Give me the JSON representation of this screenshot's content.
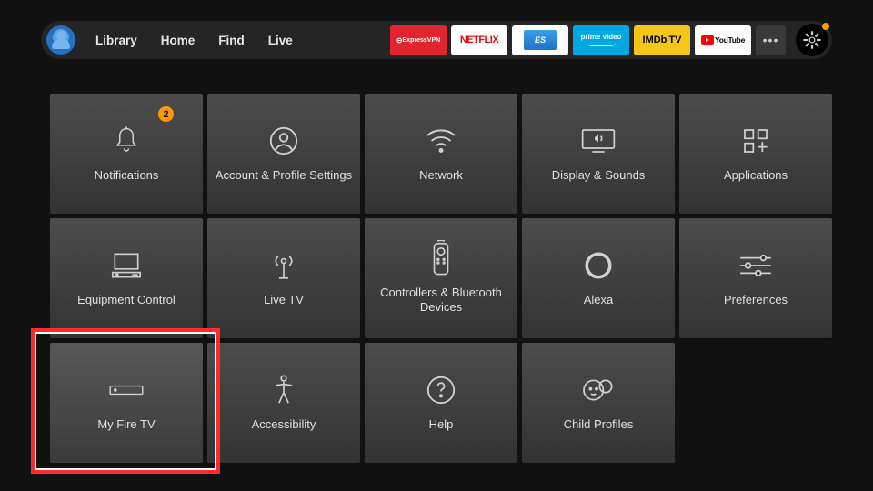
{
  "nav": {
    "items": [
      "Library",
      "Home",
      "Find",
      "Live"
    ]
  },
  "apps": {
    "express": "ExpressVPN",
    "netflix": "NETFLIX",
    "es": "ES",
    "prime_l1": "prime",
    "prime_l2": "video",
    "imdb": "IMDb",
    "imdb_tv": "TV",
    "youtube": "YouTube",
    "more": "•••"
  },
  "notifications_badge": "2",
  "tiles": [
    {
      "label": "Notifications"
    },
    {
      "label": "Account & Profile Settings"
    },
    {
      "label": "Network"
    },
    {
      "label": "Display & Sounds"
    },
    {
      "label": "Applications"
    },
    {
      "label": "Equipment Control"
    },
    {
      "label": "Live TV"
    },
    {
      "label": "Controllers & Bluetooth Devices"
    },
    {
      "label": "Alexa"
    },
    {
      "label": "Preferences"
    },
    {
      "label": "My Fire TV"
    },
    {
      "label": "Accessibility"
    },
    {
      "label": "Help"
    },
    {
      "label": "Child Profiles"
    }
  ]
}
